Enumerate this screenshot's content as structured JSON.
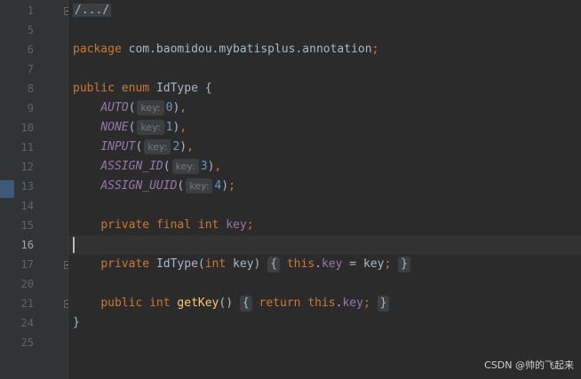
{
  "editor": {
    "lines": [
      {
        "num": "1"
      },
      {
        "num": "5"
      },
      {
        "num": "6"
      },
      {
        "num": "7"
      },
      {
        "num": "8"
      },
      {
        "num": "9"
      },
      {
        "num": "10"
      },
      {
        "num": "11"
      },
      {
        "num": "12"
      },
      {
        "num": "13"
      },
      {
        "num": "14"
      },
      {
        "num": "15"
      },
      {
        "num": "16"
      },
      {
        "num": "17"
      },
      {
        "num": "20"
      },
      {
        "num": "21"
      },
      {
        "num": "24"
      },
      {
        "num": "25"
      }
    ],
    "code": {
      "folded_header": "/.../",
      "package_kw": "package",
      "package_name": "com.baomidou.mybatisplus.annotation",
      "public_kw": "public",
      "enum_kw": "enum",
      "enum_name": "IdType",
      "hint_key": "key:",
      "constants": [
        {
          "name": "AUTO",
          "value": "0"
        },
        {
          "name": "NONE",
          "value": "1"
        },
        {
          "name": "INPUT",
          "value": "2"
        },
        {
          "name": "ASSIGN_ID",
          "value": "3"
        },
        {
          "name": "ASSIGN_UUID",
          "value": "4"
        }
      ],
      "private_kw": "private",
      "final_kw": "final",
      "int_kw": "int",
      "field_name": "key",
      "this_kw": "this",
      "return_kw": "return",
      "method_name": "getKey"
    }
  },
  "watermark": "CSDN @帅的飞起来"
}
